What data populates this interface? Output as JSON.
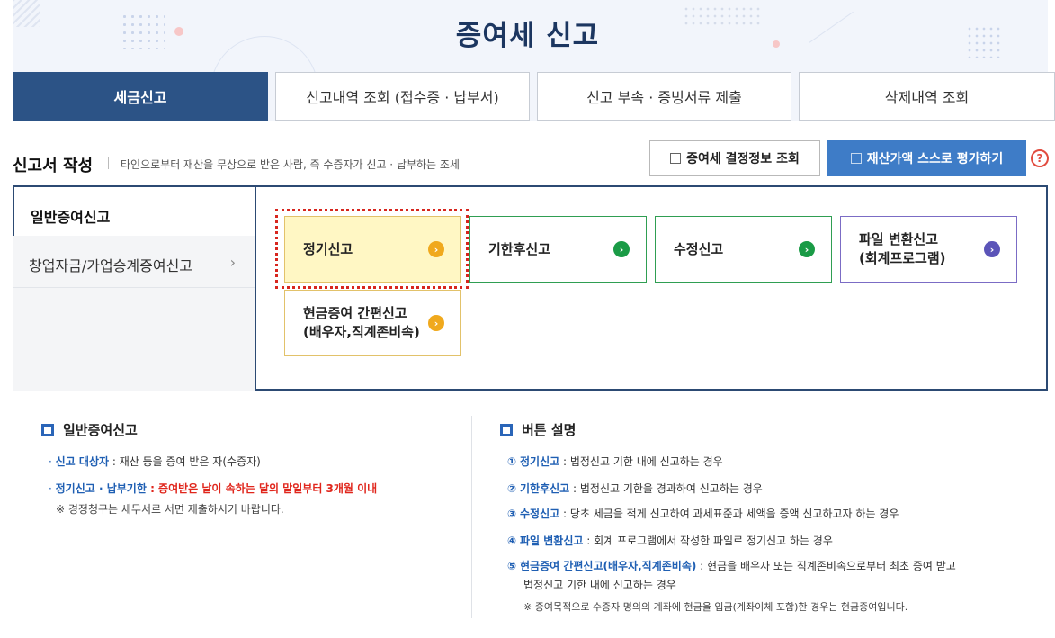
{
  "page": {
    "title": "증여세 신고"
  },
  "tabs": [
    {
      "label": "세금신고",
      "active": true
    },
    {
      "label": "신고내역 조회 (접수증 · 납부서)",
      "active": false
    },
    {
      "label": "신고 부속 · 증빙서류 제출",
      "active": false
    },
    {
      "label": "삭제내역 조회",
      "active": false
    }
  ],
  "section": {
    "title": "신고서 작성",
    "description": "타인으로부터 재산을 무상으로 받은 사람, 즉 수증자가 신고 · 납부하는 조세",
    "btn_decision": "증여세 결정정보 조회",
    "btn_self_eval": "재산가액 스스로 평가하기",
    "help": "?"
  },
  "left_menu": [
    {
      "label": "일반증여신고",
      "active": true
    },
    {
      "label": "창업자금/가업승계증여신고",
      "chevron": "›"
    }
  ],
  "options": [
    {
      "line1": "정기신고",
      "line2": "",
      "arrow": "›"
    },
    {
      "line1": "기한후신고",
      "line2": "",
      "arrow": "›"
    },
    {
      "line1": "수정신고",
      "line2": "",
      "arrow": "›"
    },
    {
      "line1": "파일 변환신고",
      "line2": "(회계프로그램)",
      "arrow": "›"
    },
    {
      "line1": "현금증여 간편신고",
      "line2": "(배우자,직계존비속)",
      "arrow": "›"
    }
  ],
  "colors": {
    "navy": "#2c5386",
    "blue_button": "#3e7cc7",
    "green": "#1a9b46",
    "orange": "#f0a91d",
    "violet": "#5b54b8",
    "red": "#e0261c"
  },
  "info_left": {
    "title": "일반증여신고",
    "l1_label": "신고 대상자",
    "l1_text": " : 재산 등을 증여 받은 자(수증자)",
    "l2_label": "정기신고 · 납부기한",
    "l2_text": " : 증여받은 날이 속하는 달의 말일부터 3개월 이내",
    "l3_text": "※ 경정청구는 세무서로 서면 제출하시기 바랍니다."
  },
  "info_right": {
    "title": "버튼 설명",
    "items": [
      {
        "num": "①",
        "label": "정기신고",
        "text": " : 법정신고 기한 내에 신고하는 경우"
      },
      {
        "num": "②",
        "label": "기한후신고",
        "text": " : 법정신고 기한을 경과하여 신고하는 경우"
      },
      {
        "num": "③",
        "label": "수정신고",
        "text": " : 당초 세금을 적게 신고하여 과세표준과 세액을 증액 신고하고자 하는 경우"
      },
      {
        "num": "④",
        "label": "파일 변환신고",
        "text": " : 회계 프로그램에서 작성한 파일로 정기신고 하는 경우"
      },
      {
        "num": "⑤",
        "label": "현금증여 간편신고(배우자,직계존비속)",
        "text": " : 현금을 배우자 또는 직계존비속으로부터 최초 증여 받고"
      }
    ],
    "item5_cont": "법정신고 기한 내에 신고하는 경우",
    "note": "※ 증여목적으로 수증자 명의의 계좌에 현금을 입금(계좌이체 포함)한 경우는 현금증여입니다."
  }
}
